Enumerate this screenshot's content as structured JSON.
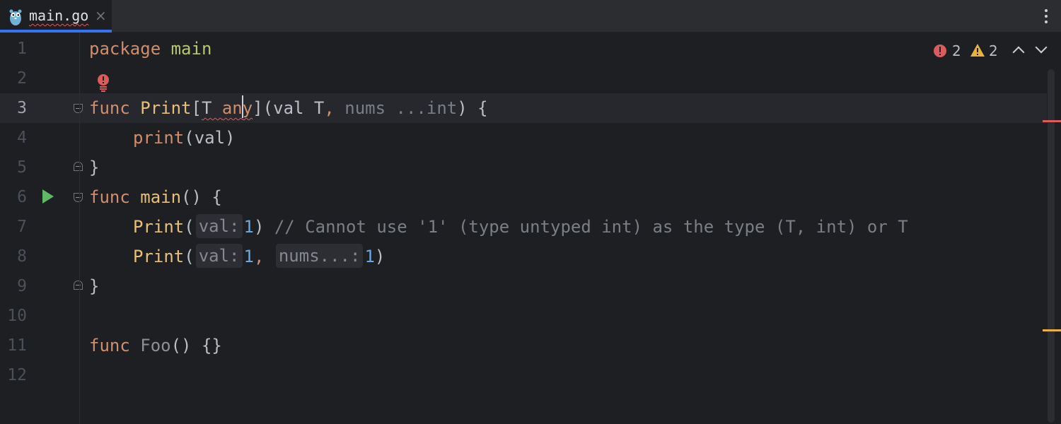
{
  "tab": {
    "name": "main.go",
    "close_glyph": "×"
  },
  "inspection": {
    "error_count": "2",
    "warning_count": "2"
  },
  "line_numbers": [
    "1",
    "2",
    "3",
    "4",
    "5",
    "6",
    "7",
    "8",
    "9",
    "10",
    "11",
    "12"
  ],
  "code": {
    "l1": {
      "kw": "package",
      "name": "main"
    },
    "l3": {
      "kw": "func",
      "fn": "Print",
      "open": "[",
      "t": "T ",
      "a": "an",
      "y": "y",
      "rest1": "](",
      "val": "val T",
      "comma": ",",
      "nums": " nums ...int",
      "rest2": ") {"
    },
    "l4": {
      "fn": "print",
      "rest": "(val)"
    },
    "l5": {
      "brace": "}"
    },
    "l6": {
      "kw": "func",
      "fn": "main",
      "rest": "() {"
    },
    "l7": {
      "fn": "Print",
      "open": "(",
      "hint": "val:",
      "num": "1",
      "rest": ") ",
      "comment": "// Cannot use '1' (type untyped int) as the type (T, int) or T"
    },
    "l8": {
      "fn": "Print",
      "open": "(",
      "hint1": "val:",
      "num1": "1",
      "comma": ",",
      "hint2": "nums...:",
      "num2": "1",
      "rest": ")"
    },
    "l9": {
      "brace": "}"
    },
    "l11": {
      "kw": "func",
      "fn": "Foo",
      "rest": "() {}"
    }
  },
  "colors": {
    "background": "#1e1f22",
    "keyword": "#cf8e6d",
    "function": "#e6c07b",
    "error": "#db5c5c",
    "warning": "#e6b33e",
    "run": "#5fb865",
    "accent": "#3574f0"
  },
  "icons": {
    "tab_icon": "gopher-icon",
    "gutter_run": "run-icon",
    "intention": "error-bulb-icon",
    "more": "more-vertical-icon"
  }
}
